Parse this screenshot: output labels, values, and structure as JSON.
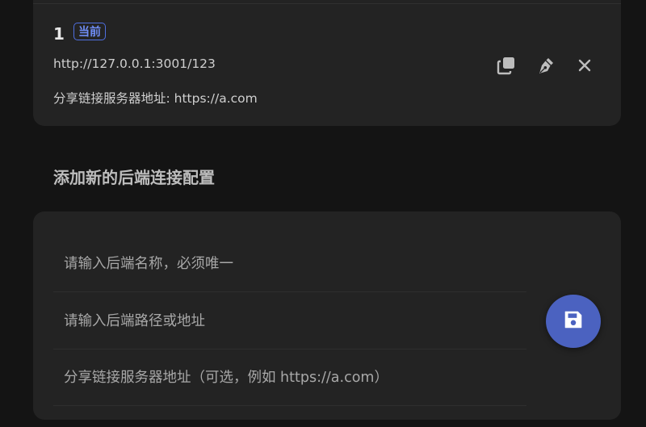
{
  "current_entry": {
    "index": "1",
    "badge": "当前",
    "url": "http://127.0.0.1:3001/123",
    "share_server": "分享链接服务器地址: https://a.com",
    "actions": [
      "copy-icon",
      "edit-pen-icon",
      "close-icon"
    ]
  },
  "add_section": {
    "title": "添加新的后端连接配置",
    "fields": [
      {
        "placeholder": "请输入后端名称，必须唯一",
        "value": ""
      },
      {
        "placeholder": "请输入后端路径或地址",
        "value": ""
      },
      {
        "placeholder": "分享链接服务器地址（可选，例如 https://a.com）",
        "value": ""
      }
    ],
    "save_icon": "floppy-disk-icon"
  },
  "colors": {
    "background": "#141414",
    "card": "#232323",
    "badge_accent": "#4f6fe0",
    "save_button": "#4b62c0",
    "icon": "#bdbdbd"
  }
}
